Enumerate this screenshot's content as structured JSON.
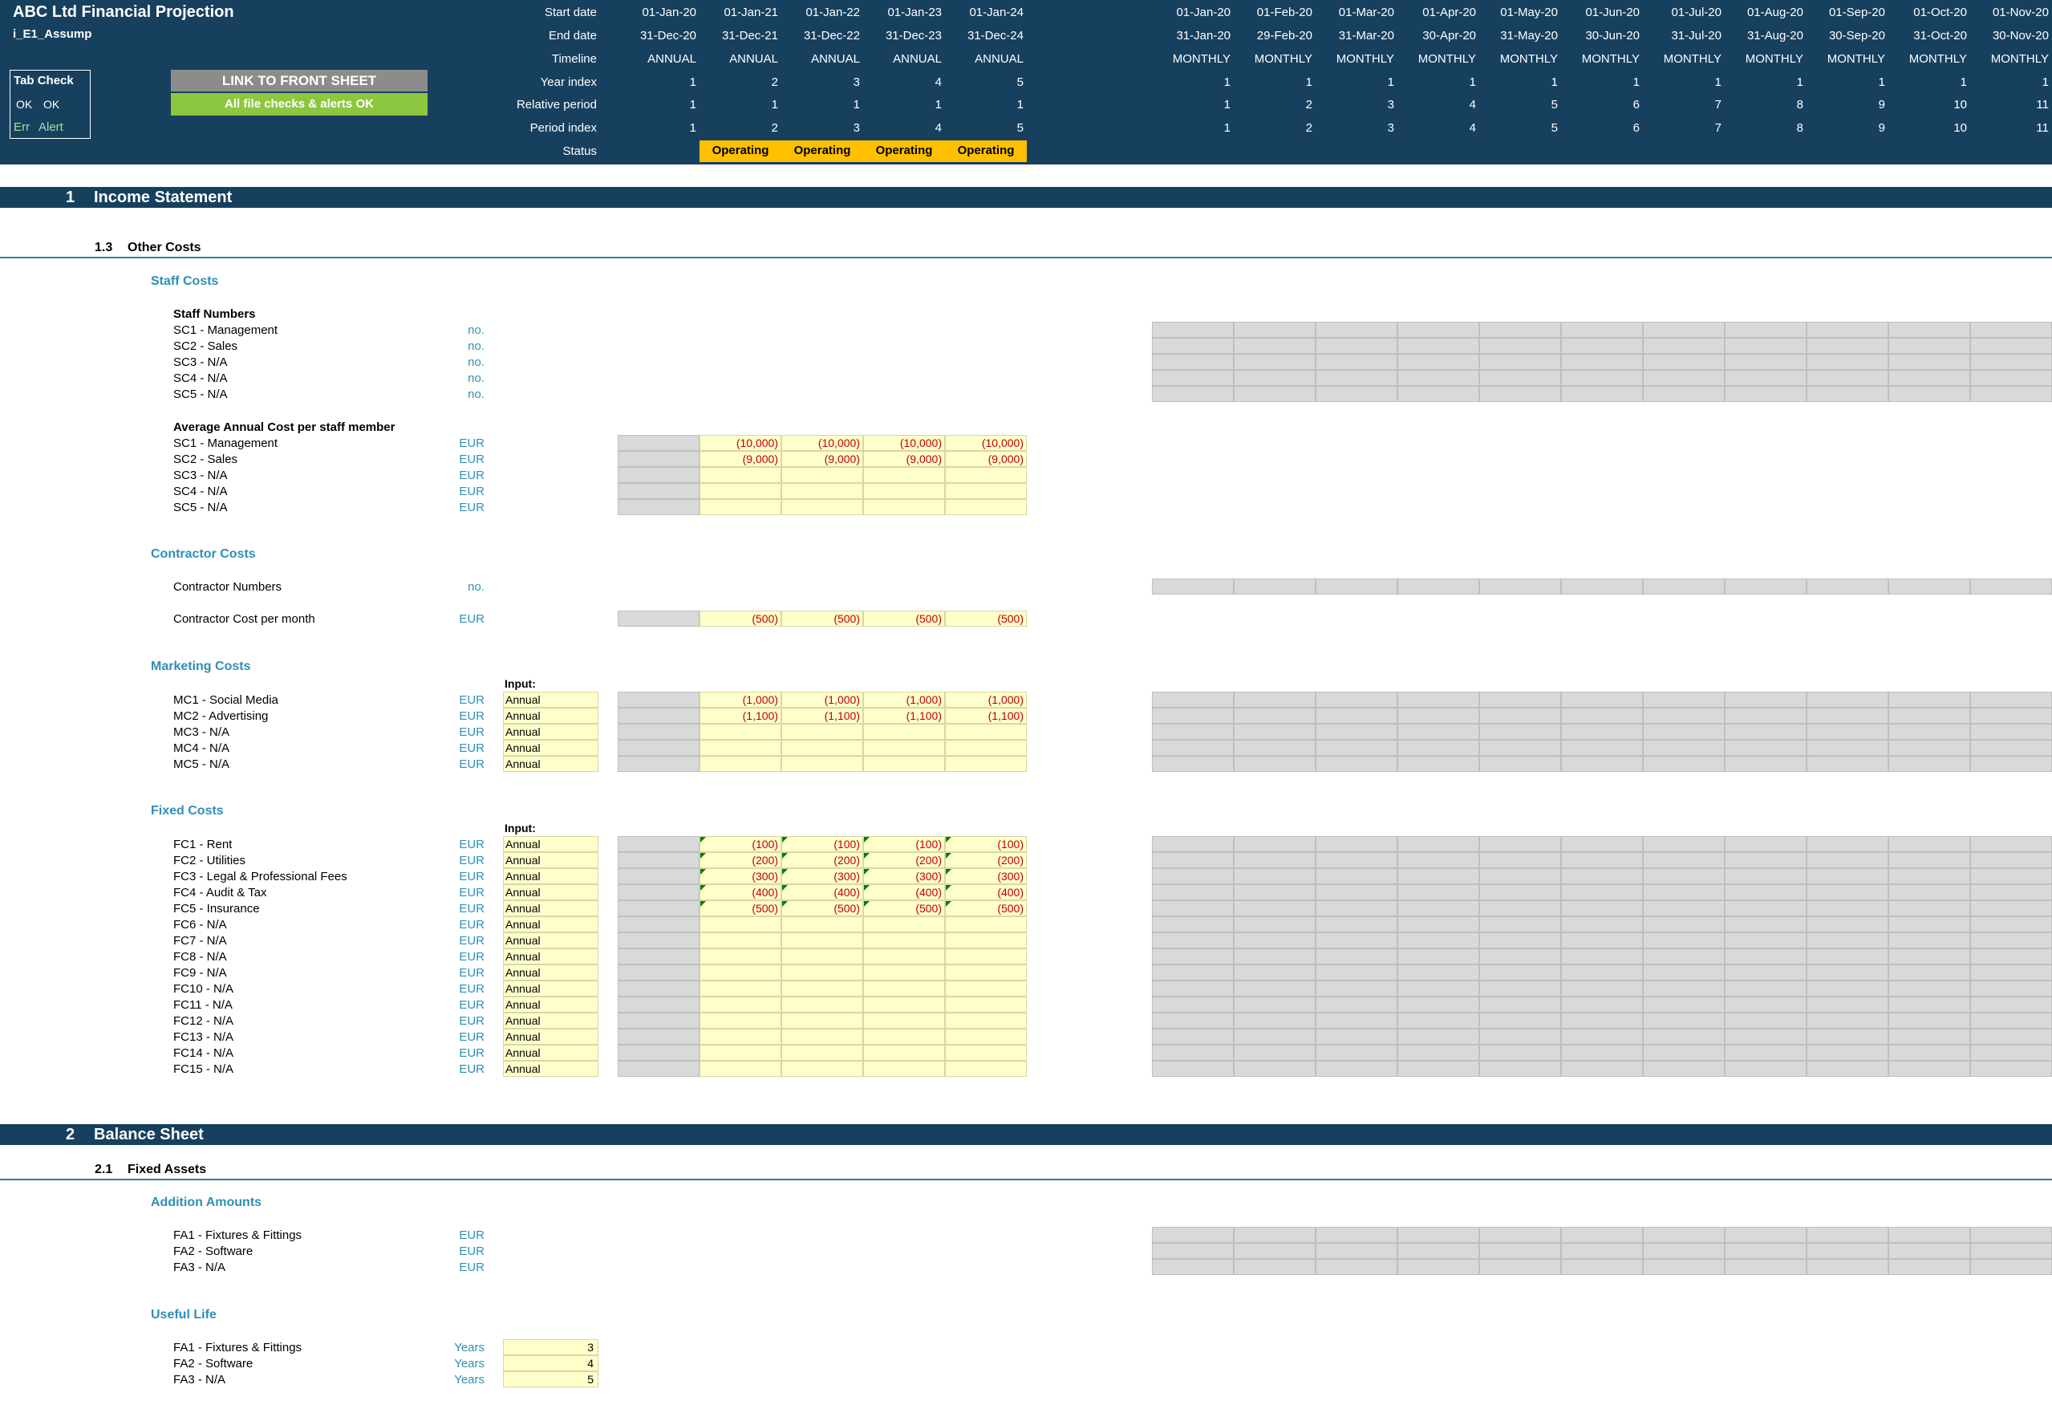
{
  "header": {
    "title": "ABC Ltd Financial Projection",
    "sheet_name": "i_E1_Assump",
    "tab_check": {
      "title": "Tab Check",
      "ok_1": "OK",
      "ok_2": "OK",
      "err": "Err",
      "alert": "Alert"
    },
    "link_button": "LINK TO FRONT SHEET",
    "checks_status": "All file checks & alerts OK",
    "row_labels": [
      "Start date",
      "End date",
      "Timeline",
      "Year index",
      "Relative period",
      "Period index",
      "Status"
    ],
    "annual": {
      "start": [
        "01-Jan-20",
        "01-Jan-21",
        "01-Jan-22",
        "01-Jan-23",
        "01-Jan-24"
      ],
      "end": [
        "31-Dec-20",
        "31-Dec-21",
        "31-Dec-22",
        "31-Dec-23",
        "31-Dec-24"
      ],
      "timeline": [
        "ANNUAL",
        "ANNUAL",
        "ANNUAL",
        "ANNUAL",
        "ANNUAL"
      ],
      "year_index": [
        "1",
        "2",
        "3",
        "4",
        "5"
      ],
      "relative_period": [
        "1",
        "1",
        "1",
        "1",
        "1"
      ],
      "period_index": [
        "1",
        "2",
        "3",
        "4",
        "5"
      ],
      "status": [
        "",
        "Operating",
        "Operating",
        "Operating",
        "Operating"
      ]
    },
    "monthly": {
      "start": [
        "01-Jan-20",
        "01-Feb-20",
        "01-Mar-20",
        "01-Apr-20",
        "01-May-20",
        "01-Jun-20",
        "01-Jul-20",
        "01-Aug-20",
        "01-Sep-20",
        "01-Oct-20",
        "01-Nov-20"
      ],
      "end": [
        "31-Jan-20",
        "29-Feb-20",
        "31-Mar-20",
        "30-Apr-20",
        "31-May-20",
        "30-Jun-20",
        "31-Jul-20",
        "31-Aug-20",
        "30-Sep-20",
        "31-Oct-20",
        "30-Nov-20"
      ],
      "timeline": [
        "MONTHLY",
        "MONTHLY",
        "MONTHLY",
        "MONTHLY",
        "MONTHLY",
        "MONTHLY",
        "MONTHLY",
        "MONTHLY",
        "MONTHLY",
        "MONTHLY",
        "MONTHLY"
      ],
      "year_index": [
        "1",
        "1",
        "1",
        "1",
        "1",
        "1",
        "1",
        "1",
        "1",
        "1",
        "1"
      ],
      "relative_period": [
        "1",
        "2",
        "3",
        "4",
        "5",
        "6",
        "7",
        "8",
        "9",
        "10",
        "11"
      ],
      "period_index": [
        "1",
        "2",
        "3",
        "4",
        "5",
        "6",
        "7",
        "8",
        "9",
        "10",
        "11"
      ]
    }
  },
  "sections": {
    "s1_num": "1",
    "s1_title": "Income Statement",
    "s13_num": "1.3",
    "s13_title": "Other Costs",
    "s2_num": "2",
    "s2_title": "Balance Sheet",
    "s21_num": "2.1",
    "s21_title": "Fixed Assets"
  },
  "staff": {
    "group": "Staff Costs",
    "numbers_title": "Staff Numbers",
    "numbers": [
      {
        "label": "SC1 - Management",
        "unit": "no."
      },
      {
        "label": "SC2 - Sales",
        "unit": "no."
      },
      {
        "label": "SC3 - N/A",
        "unit": "no."
      },
      {
        "label": "SC4 - N/A",
        "unit": "no."
      },
      {
        "label": "SC5 - N/A",
        "unit": "no."
      }
    ],
    "cost_title": "Average Annual Cost per staff member",
    "costs": [
      {
        "label": "SC1 - Management",
        "unit": "EUR",
        "values": [
          "(10,000)",
          "(10,000)",
          "(10,000)",
          "(10,000)"
        ]
      },
      {
        "label": "SC2 - Sales",
        "unit": "EUR",
        "values": [
          "(9,000)",
          "(9,000)",
          "(9,000)",
          "(9,000)"
        ]
      },
      {
        "label": "SC3 - N/A",
        "unit": "EUR",
        "values": [
          "",
          "",
          "",
          ""
        ]
      },
      {
        "label": "SC4 - N/A",
        "unit": "EUR",
        "values": [
          "",
          "",
          "",
          ""
        ]
      },
      {
        "label": "SC5 - N/A",
        "unit": "EUR",
        "values": [
          "",
          "",
          "",
          ""
        ]
      }
    ]
  },
  "contractor": {
    "group": "Contractor Costs",
    "numbers_label": "Contractor Numbers",
    "numbers_unit": "no.",
    "cost_label": "Contractor Cost per month",
    "cost_unit": "EUR",
    "cost_values": [
      "(500)",
      "(500)",
      "(500)",
      "(500)"
    ]
  },
  "marketing": {
    "group": "Marketing Costs",
    "input_label": "Input:",
    "rows": [
      {
        "label": "MC1 - Social Media",
        "unit": "EUR",
        "input": "Annual",
        "values": [
          "(1,000)",
          "(1,000)",
          "(1,000)",
          "(1,000)"
        ]
      },
      {
        "label": "MC2 - Advertising",
        "unit": "EUR",
        "input": "Annual",
        "values": [
          "(1,100)",
          "(1,100)",
          "(1,100)",
          "(1,100)"
        ]
      },
      {
        "label": "MC3 - N/A",
        "unit": "EUR",
        "input": "Annual",
        "values": [
          "",
          "",
          "",
          ""
        ]
      },
      {
        "label": "MC4 - N/A",
        "unit": "EUR",
        "input": "Annual",
        "values": [
          "",
          "",
          "",
          ""
        ]
      },
      {
        "label": "MC5 - N/A",
        "unit": "EUR",
        "input": "Annual",
        "values": [
          "",
          "",
          "",
          ""
        ]
      }
    ]
  },
  "fixed": {
    "group": "Fixed Costs",
    "input_label": "Input:",
    "rows": [
      {
        "label": "FC1 - Rent",
        "unit": "EUR",
        "input": "Annual",
        "values": [
          "(100)",
          "(100)",
          "(100)",
          "(100)"
        ]
      },
      {
        "label": "FC2 - Utilities",
        "unit": "EUR",
        "input": "Annual",
        "values": [
          "(200)",
          "(200)",
          "(200)",
          "(200)"
        ]
      },
      {
        "label": "FC3 - Legal & Professional Fees",
        "unit": "EUR",
        "input": "Annual",
        "values": [
          "(300)",
          "(300)",
          "(300)",
          "(300)"
        ]
      },
      {
        "label": "FC4 - Audit & Tax",
        "unit": "EUR",
        "input": "Annual",
        "values": [
          "(400)",
          "(400)",
          "(400)",
          "(400)"
        ]
      },
      {
        "label": "FC5 - Insurance",
        "unit": "EUR",
        "input": "Annual",
        "values": [
          "(500)",
          "(500)",
          "(500)",
          "(500)"
        ]
      },
      {
        "label": "FC6 - N/A",
        "unit": "EUR",
        "input": "Annual",
        "values": [
          "",
          "",
          "",
          ""
        ]
      },
      {
        "label": "FC7 - N/A",
        "unit": "EUR",
        "input": "Annual",
        "values": [
          "",
          "",
          "",
          ""
        ]
      },
      {
        "label": "FC8 - N/A",
        "unit": "EUR",
        "input": "Annual",
        "values": [
          "",
          "",
          "",
          ""
        ]
      },
      {
        "label": "FC9 - N/A",
        "unit": "EUR",
        "input": "Annual",
        "values": [
          "",
          "",
          "",
          ""
        ]
      },
      {
        "label": "FC10 - N/A",
        "unit": "EUR",
        "input": "Annual",
        "values": [
          "",
          "",
          "",
          ""
        ]
      },
      {
        "label": "FC11 - N/A",
        "unit": "EUR",
        "input": "Annual",
        "values": [
          "",
          "",
          "",
          ""
        ]
      },
      {
        "label": "FC12 - N/A",
        "unit": "EUR",
        "input": "Annual",
        "values": [
          "",
          "",
          "",
          ""
        ]
      },
      {
        "label": "FC13 - N/A",
        "unit": "EUR",
        "input": "Annual",
        "values": [
          "",
          "",
          "",
          ""
        ]
      },
      {
        "label": "FC14 - N/A",
        "unit": "EUR",
        "input": "Annual",
        "values": [
          "",
          "",
          "",
          ""
        ]
      },
      {
        "label": "FC15 - N/A",
        "unit": "EUR",
        "input": "Annual",
        "values": [
          "",
          "",
          "",
          ""
        ]
      }
    ]
  },
  "additions": {
    "group": "Addition Amounts",
    "rows": [
      {
        "label": "FA1 - Fixtures & Fittings",
        "unit": "EUR"
      },
      {
        "label": "FA2 - Software",
        "unit": "EUR"
      },
      {
        "label": "FA3 - N/A",
        "unit": "EUR"
      }
    ]
  },
  "useful_life": {
    "group": "Useful Life",
    "rows": [
      {
        "label": "FA1 - Fixtures & Fittings",
        "unit": "Years",
        "value": "3"
      },
      {
        "label": "FA2 - Software",
        "unit": "Years",
        "value": "4"
      },
      {
        "label": "FA3 - N/A",
        "unit": "Years",
        "value": "5"
      }
    ]
  },
  "colors": {
    "header_bg": "#17405f",
    "accent_blue": "#2e8fb8",
    "input_yellow": "#ffffcc",
    "status_orange": "#ffc000",
    "check_green": "#8dc63f",
    "negative_red": "#c00000"
  }
}
